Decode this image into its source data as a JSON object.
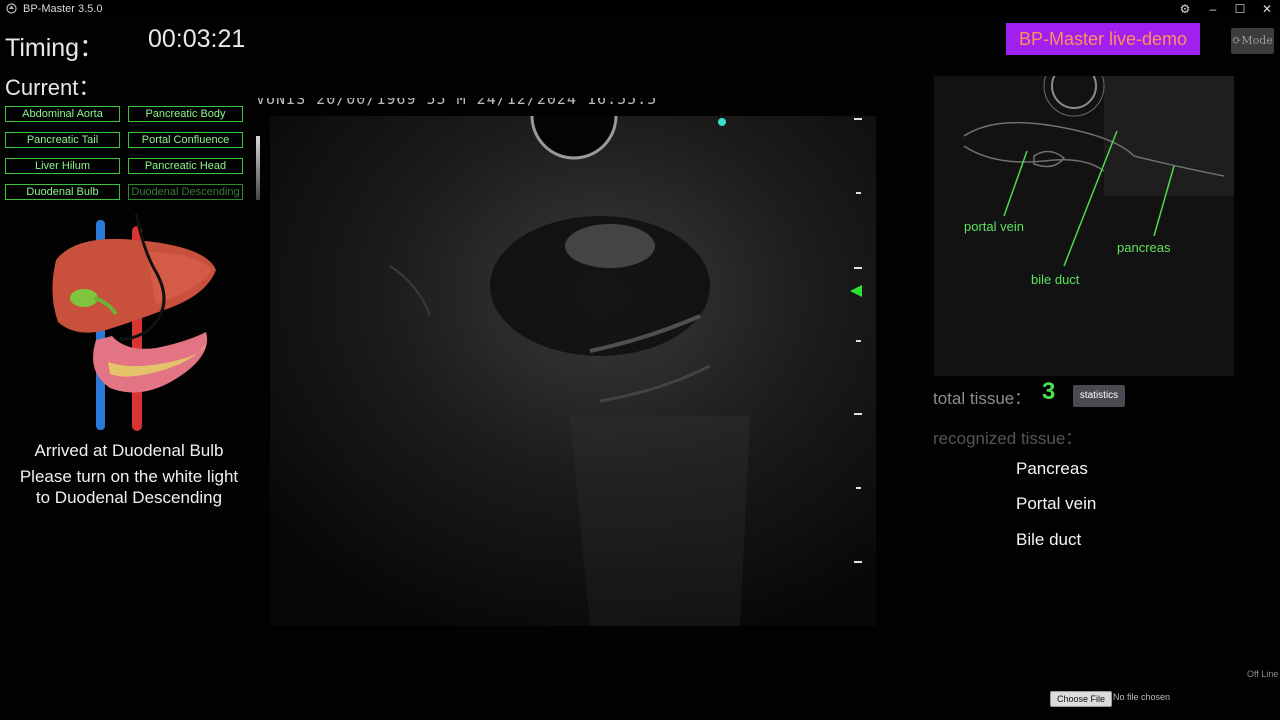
{
  "titlebar": {
    "title": "BP-Master 3.5.0",
    "icons": [
      "app-logo-icon",
      "gear-icon",
      "minimize-icon",
      "maximize-icon",
      "close-icon"
    ],
    "gear": "⚙",
    "minimize": "–",
    "maximize": "☐",
    "close": "✕"
  },
  "timing": {
    "label": "Timing：",
    "value": "00:03:21"
  },
  "current": {
    "label": "Current："
  },
  "live_demo": "BP-Master live-demo",
  "mode_button": "⟳Mode",
  "stations": [
    {
      "label": "Abdominal Aorta",
      "active": true
    },
    {
      "label": "Pancreatic Body",
      "active": true
    },
    {
      "label": "Pancreatic Tail",
      "active": true
    },
    {
      "label": "Portal Confluence",
      "active": true
    },
    {
      "label": "Liver Hilum",
      "active": true
    },
    {
      "label": "Pancreatic Head",
      "active": true
    },
    {
      "label": "Duodenal Bulb",
      "active": true
    },
    {
      "label": "Duodenal Descending",
      "active": false
    }
  ],
  "status": {
    "arrived": "Arrived at Duodenal Bulb",
    "instruction_line1": "Please turn on the white light",
    "instruction_line2": "to Duodenal Descending"
  },
  "ultrasound": {
    "header_text": "VUNIS      20/00/1969  55    M      24/12/2024 16:55:5",
    "icons": [
      "focus-marker-icon",
      "cyan-dot-icon"
    ]
  },
  "reference": {
    "labels": {
      "portal_vein": "portal vein",
      "bile_duct": "bile duct",
      "pancreas": "pancreas"
    }
  },
  "tissue_panel": {
    "total_label": "total tissue：",
    "total_count": "3",
    "statistics_button": "statistics",
    "recognized_label": "recognized tissue：",
    "recognized": [
      "Pancreas",
      "Portal vein",
      "Bile duct"
    ]
  },
  "footer": {
    "offline": "Off Line",
    "choose_file": "Choose File",
    "file_status": "No file chosen"
  },
  "colors": {
    "station_border": "#3ac43a",
    "accent_green": "#4ce04c",
    "live_demo_bg": "#a020f0",
    "live_demo_text": "#ff8f5a"
  }
}
